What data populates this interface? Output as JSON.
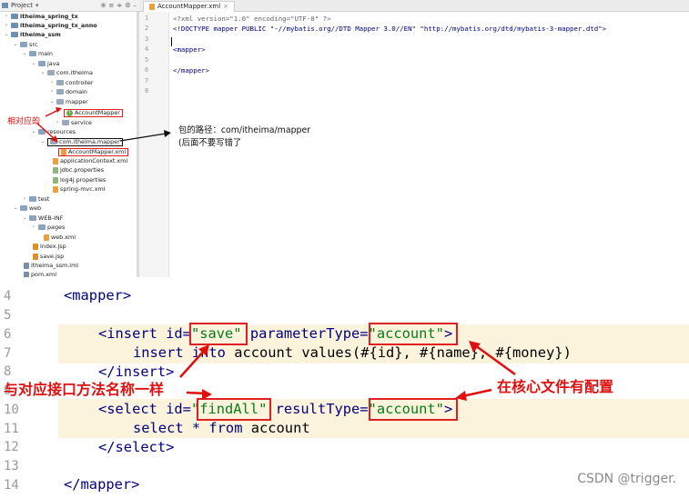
{
  "project_toolbar": {
    "label": "Project",
    "dropdown_icon": "chevron-down-icon"
  },
  "tree": {
    "items": [
      {
        "label": "itheima_spring_tx",
        "kind": "module"
      },
      {
        "label": "itheima_spring_tx_anno",
        "kind": "module"
      },
      {
        "label": "itheima_ssm",
        "kind": "module"
      },
      {
        "label": "src",
        "kind": "folder"
      },
      {
        "label": "main",
        "kind": "folder"
      },
      {
        "label": "java",
        "kind": "folder"
      },
      {
        "label": "com.itheima",
        "kind": "package"
      },
      {
        "label": "controller",
        "kind": "package"
      },
      {
        "label": "domain",
        "kind": "package"
      },
      {
        "label": "mapper",
        "kind": "package"
      },
      {
        "label": "AccountMapper",
        "kind": "interface"
      },
      {
        "label": "service",
        "kind": "package"
      },
      {
        "label": "resources",
        "kind": "folder"
      },
      {
        "label": "com.itheima.mapper",
        "kind": "package"
      },
      {
        "label": "AccountMapper.xml",
        "kind": "xml"
      },
      {
        "label": "applicationContext.xml",
        "kind": "xml"
      },
      {
        "label": "jdbc.properties",
        "kind": "properties"
      },
      {
        "label": "log4j.properties",
        "kind": "properties"
      },
      {
        "label": "spring-mvc.xml",
        "kind": "xml"
      },
      {
        "label": "test",
        "kind": "folder"
      },
      {
        "label": "web",
        "kind": "folder"
      },
      {
        "label": "WEB-INF",
        "kind": "folder"
      },
      {
        "label": "pages",
        "kind": "folder"
      },
      {
        "label": "web.xml",
        "kind": "xml"
      },
      {
        "label": "index.jsp",
        "kind": "jsp"
      },
      {
        "label": "save.jsp",
        "kind": "jsp"
      },
      {
        "label": "itheima_ssm.iml",
        "kind": "iml"
      },
      {
        "label": "pom.xml",
        "kind": "xml"
      }
    ]
  },
  "editor": {
    "tab_label": "AccountMapper.xml",
    "lines": [
      {
        "num": "1",
        "text": "<?xml version=\"1.0\" encoding=\"UTF-8\" ?>"
      },
      {
        "num": "2",
        "text": "<!DOCTYPE mapper PUBLIC \"-//mybatis.org//DTD Mapper 3.0//EN\" \"http://mybatis.org/dtd/mybatis-3-mapper.dtd\">"
      },
      {
        "num": "3",
        "text": ""
      },
      {
        "num": "4",
        "text": "<mapper>"
      },
      {
        "num": "5",
        "text": ""
      },
      {
        "num": "6",
        "text": "</mapper>"
      },
      {
        "num": "7",
        "text": ""
      },
      {
        "num": "8",
        "text": ""
      }
    ]
  },
  "annotations": {
    "relative_label": "相对应的",
    "path_note_line1": "包的路径：com/itheima/mapper",
    "path_note_line2": "(后面不要写错了",
    "same_name_note": "与对应接口方法名称一样",
    "core_config_note": "在核心文件有配置"
  },
  "zoom_code": {
    "line_numbers": [
      "4",
      "5",
      "6",
      "7",
      "8",
      "9",
      "10",
      "11",
      "12",
      "13",
      "14"
    ],
    "mapper_open": "<mapper>",
    "insert_open_prefix": "<insert id=",
    "insert_id": "\"save\"",
    "insert_attr": " parameterType=",
    "insert_param": "\"account\"",
    "insert_close_bracket": ">",
    "insert_sql_kw1": "insert into",
    "insert_sql_rest": " account values(#{id}, #{name}, #{money})",
    "insert_close": "</insert>",
    "select_open_prefix": "<select id=",
    "select_id": "\"findAll\"",
    "select_attr": " resultType=",
    "select_result": "\"account\"",
    "select_close_bracket": ">",
    "select_sql_kw1": "select * from",
    "select_sql_rest": " account",
    "select_close": "</select>",
    "mapper_close": "</mapper>"
  },
  "watermark": "CSDN @trigger.",
  "colors": {
    "annotation_red": "#e01010",
    "highlight_bg": "#fbf3dc",
    "tag_navy": "#000080",
    "string_green": "#067d17"
  }
}
